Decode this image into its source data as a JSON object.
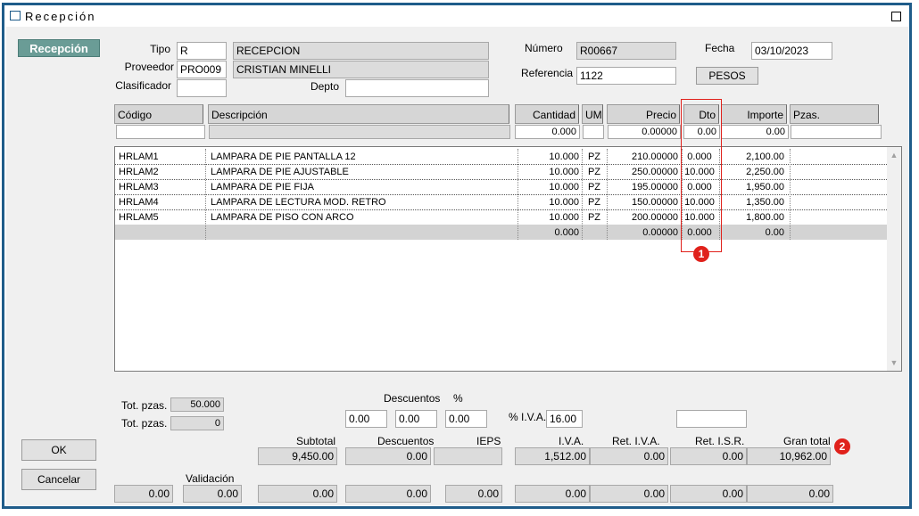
{
  "window": {
    "title": "Recepción"
  },
  "side_tab": "Recepción",
  "form": {
    "tipo_label": "Tipo",
    "tipo_value": "R",
    "tipo_desc": "RECEPCION",
    "proveedor_label": "Proveedor",
    "proveedor_value": "PRO009",
    "proveedor_name": "CRISTIAN MINELLI",
    "clasificador_label": "Clasificador",
    "clasificador_value": "",
    "depto_label": "Depto",
    "depto_value": "",
    "numero_label": "Número",
    "numero_value": "R00667",
    "referencia_label": "Referencia",
    "referencia_value": "1122",
    "fecha_label": "Fecha",
    "fecha_value": "03/10/2023",
    "currency_button": "PESOS"
  },
  "grid": {
    "headers": [
      "Código",
      "Descripción",
      "Cantidad",
      "UM",
      "Precio",
      "Dto",
      "Importe",
      "Pzas."
    ],
    "entry": {
      "codigo": "",
      "descripcion": "",
      "cantidad": "0.000",
      "um": "",
      "precio": "0.00000",
      "dto": "0.00",
      "importe": "0.00",
      "pzas": ""
    },
    "rows": [
      {
        "codigo": "HRLAM1",
        "descripcion": "LAMPARA DE PIE PANTALLA 12",
        "cantidad": "10.000",
        "um": "PZ",
        "precio": "210.00000",
        "dto": "0.000",
        "importe": "2,100.00"
      },
      {
        "codigo": "HRLAM2",
        "descripcion": "LAMPARA DE PIE AJUSTABLE",
        "cantidad": "10.000",
        "um": "PZ",
        "precio": "250.00000",
        "dto": "10.000",
        "importe": "2,250.00"
      },
      {
        "codigo": "HRLAM3",
        "descripcion": "LAMPARA DE PIE FIJA",
        "cantidad": "10.000",
        "um": "PZ",
        "precio": "195.00000",
        "dto": "0.000",
        "importe": "1,950.00"
      },
      {
        "codigo": "HRLAM4",
        "descripcion": "LAMPARA DE LECTURA MOD. RETRO",
        "cantidad": "10.000",
        "um": "PZ",
        "precio": "150.00000",
        "dto": "10.000",
        "importe": "1,350.00"
      },
      {
        "codigo": "HRLAM5",
        "descripcion": "LAMPARA DE PISO CON ARCO",
        "cantidad": "10.000",
        "um": "PZ",
        "precio": "200.00000",
        "dto": "10.000",
        "importe": "1,800.00"
      }
    ],
    "total_row": {
      "cantidad": "0.000",
      "precio": "0.00000",
      "dto": "0.000",
      "importe": "0.00"
    }
  },
  "summary": {
    "tot_pzas_label": "Tot. pzas.",
    "tot_pzas_1": "50.000",
    "tot_pzas_2": "0",
    "descuentos_label": "Descuentos",
    "percent_label": "%",
    "desc_1": "0.00",
    "desc_2": "0.00",
    "desc_3": "0.00",
    "iva_pct_label": "% I.V.A.",
    "iva_pct_value": "16.00",
    "extra_field": "",
    "subtotal_label": "Subtotal",
    "subtotal_value": "9,450.00",
    "descuentos_col_label": "Descuentos",
    "descuentos_value": "0.00",
    "ieps_label": "IEPS",
    "ieps_value": "",
    "iva_label": "I.V.A.",
    "iva_value": "1,512.00",
    "ret_iva_label": "Ret. I.V.A.",
    "ret_iva_value": "0.00",
    "ret_isr_label": "Ret. I.S.R.",
    "ret_isr_value": "0.00",
    "gran_total_label": "Gran total",
    "gran_total_value": "10,962.00",
    "validacion_label": "Validación",
    "bottom_values": [
      "0.00",
      "0.00",
      "0.00",
      "0.00",
      "0.00",
      "0.00",
      "0.00",
      "0.00",
      "0.00"
    ]
  },
  "buttons": {
    "ok": "OK",
    "cancel": "Cancelar"
  },
  "annotations": [
    "1",
    "2"
  ],
  "colors": {
    "frame": "#1f5c8a",
    "side_tab": "#6a9c96",
    "highlight": "#e0211b"
  }
}
